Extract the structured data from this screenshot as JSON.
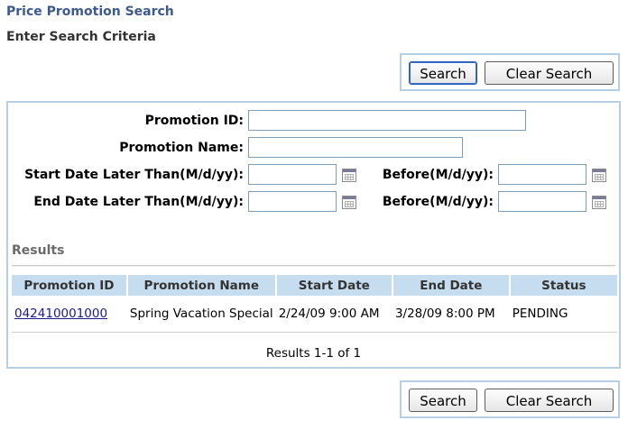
{
  "page": {
    "title": "Price Promotion Search",
    "subtitle": "Enter Search Criteria"
  },
  "buttons": {
    "search_label": "Search",
    "clear_label": "Clear Search"
  },
  "form": {
    "promotion_id": {
      "label": "Promotion ID:",
      "value": ""
    },
    "promotion_name": {
      "label": "Promotion Name:",
      "value": ""
    },
    "start_after": {
      "label": "Start Date Later Than(M/d/yy):",
      "value": ""
    },
    "start_before": {
      "label": "Before(M/d/yy):",
      "value": ""
    },
    "end_after": {
      "label": "End Date Later Than(M/d/yy):",
      "value": ""
    },
    "end_before": {
      "label": "Before(M/d/yy):",
      "value": ""
    }
  },
  "results": {
    "heading": "Results",
    "columns": [
      "Promotion ID",
      "Promotion Name",
      "Start Date",
      "End Date",
      "Status"
    ],
    "rows": [
      {
        "promotion_id": "042410001000",
        "promotion_name": "Spring Vacation Special",
        "start_date": "2/24/09 9:00 AM",
        "end_date": "3/28/09 8:00 PM",
        "status": "PENDING"
      }
    ],
    "pager_text": "Results 1-1 of 1"
  },
  "icons": {
    "calendar": "calendar-icon"
  },
  "colors": {
    "title": "#3c5a8c",
    "panel_border": "#b4cfe6",
    "table_header": "#c6dcef",
    "link": "#1a1a8c"
  }
}
